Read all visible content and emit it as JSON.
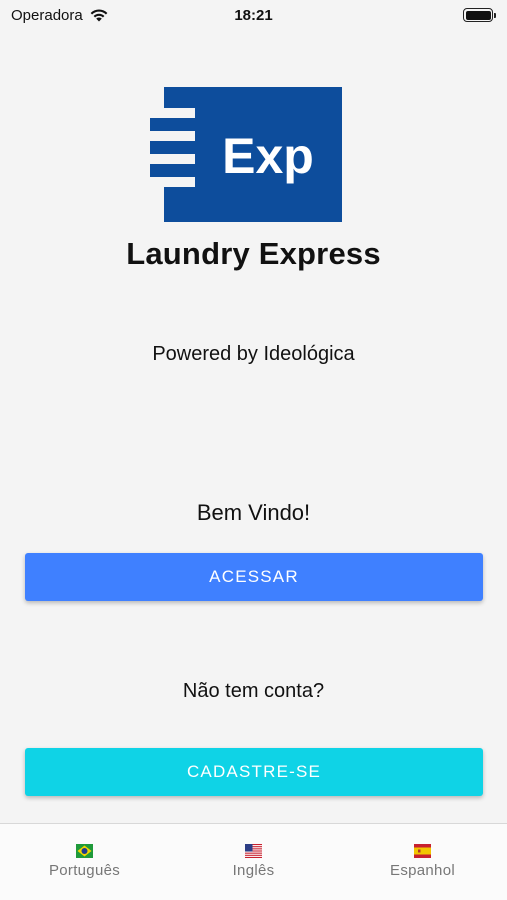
{
  "status_bar": {
    "carrier": "Operadora",
    "time": "18:21"
  },
  "logo": {
    "text": "Exp",
    "color": "#0d4d9c"
  },
  "app_name": "Laundry Express",
  "powered_by": "Powered by Ideológica",
  "welcome": "Bem Vindo!",
  "access_button": "ACESSAR",
  "no_account": "Não tem conta?",
  "signup_button": "CADASTRE-SE",
  "colors": {
    "access_button": "#3f80ff",
    "signup_button": "#0fd3e6",
    "background": "#f4f4f4"
  },
  "language_tabs": [
    {
      "label": "Português",
      "icon": "brazil-flag-icon"
    },
    {
      "label": "Inglês",
      "icon": "usa-flag-icon"
    },
    {
      "label": "Espanhol",
      "icon": "spain-flag-icon"
    }
  ]
}
